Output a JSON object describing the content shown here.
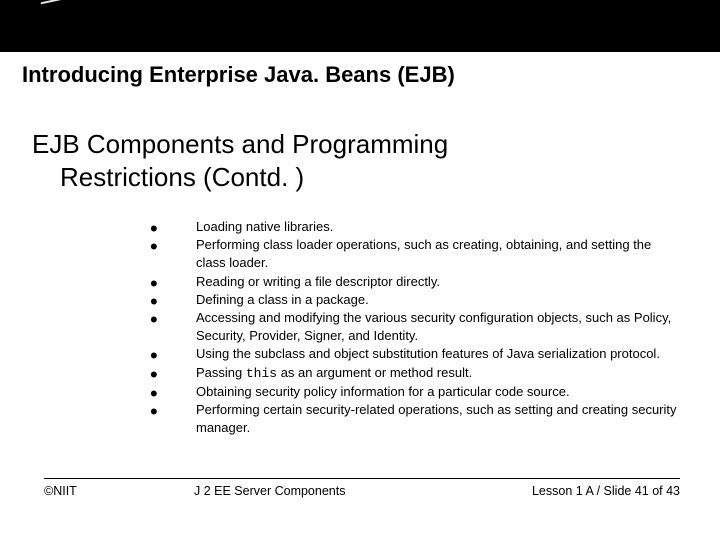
{
  "header": {
    "title": "Introducing Enterprise Java. Beans (EJB)"
  },
  "subtitle": {
    "line1": "EJB Components and Programming",
    "line2": "Restrictions (Contd. )"
  },
  "bullets": [
    "Loading native libraries.",
    "Performing class loader operations, such as creating, obtaining, and setting the class loader.",
    "Reading or writing a file descriptor directly.",
    "Defining a class in a package.",
    "Accessing and modifying the various security configuration objects, such as  Policy, Security, Provider, Signer, and Identity.",
    "Using the subclass and object substitution features of Java serialization protocol.",
    "Passing |CODE|this|/CODE| as an argument or method result.",
    "Obtaining security policy information for a particular code source.",
    "Performing certain security-related operations, such as setting and creating security manager."
  ],
  "footer": {
    "left": "©NIIT",
    "center": "J 2 EE Server Components",
    "right_prefix": "Lesson 1 A / Slide ",
    "slide_current": 41,
    "slide_total": 43
  }
}
